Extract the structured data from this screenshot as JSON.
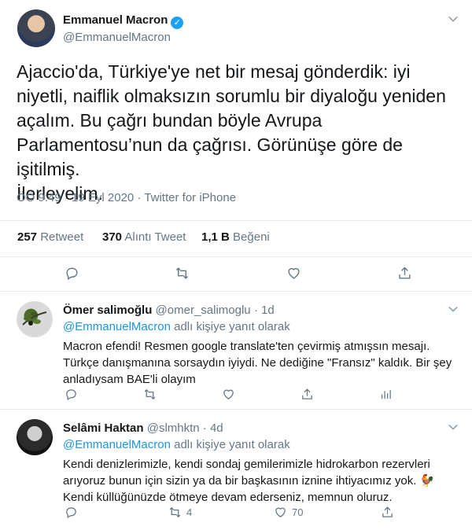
{
  "main": {
    "name": "Emmanuel Macron",
    "handle": "@EmmanuelMacron",
    "text": "Ajaccio'da, Türkiye'ye net bir mesaj gönderdik: iyi\nniyetli, naiflik olmaksızın sorumlu bir diyaloğu yeniden\naçalım. Bu çağrı bundan böyle Avrupa\nParlamentosu’nun da çağrısı. Görünüşe göre de işitilmiş.\nİlerleyelim.",
    "meta": "ÖÖ 9:49 · 19 Eyl 2020 · Twitter for iPhone",
    "retweets_count": "257",
    "retweets_label": "Retweet",
    "quotes_count": "370",
    "quotes_label": "Alıntı Tweet",
    "likes_count": "1,1 B",
    "likes_label": "Beğeni"
  },
  "replies": [
    {
      "name": "Ömer salimoğlu",
      "handle_time": "@omer_salimoglu · 1d",
      "reply_to_link": "@EmmanuelMacron",
      "reply_to_suffix": "adlı kişiye yanıt olarak",
      "text": "Macron efendi! Resmen google translate'ten çevirmiş atmışsın mesajı. Türkçe danışmanına sorsaydın iyiydi. Ne dediğine \"Fransız\" kaldık. Bir şey anladıysam BAE'li olayım",
      "retweet_count": "",
      "like_count": ""
    },
    {
      "name": "Selâmi Haktan",
      "handle_time": "@slmhktn · 4d",
      "reply_to_link": "@EmmanuelMacron",
      "reply_to_suffix": "adlı kişiye yanıt olarak",
      "text": "Kendi denizlerimizle, kendi sondaj gemilerimizle hidrokarbon rezervleri arıyoruz bunun için sizin ya da bir başkasının iznine ihtiyacımız yok. 🐓 Kendi küllüğünüzde ötmeye devam ederseniz, memnun oluruz.",
      "retweet_count": "4",
      "like_count": "70"
    }
  ],
  "icons": {
    "reply": "reply-icon",
    "retweet": "retweet-icon",
    "like": "heart-icon",
    "share": "share-icon",
    "more": "chevron-down-icon",
    "verified": "verified-badge-icon"
  },
  "colors": {
    "accent": "#1da1f2",
    "link": "#1b95e0",
    "muted": "#657786"
  }
}
